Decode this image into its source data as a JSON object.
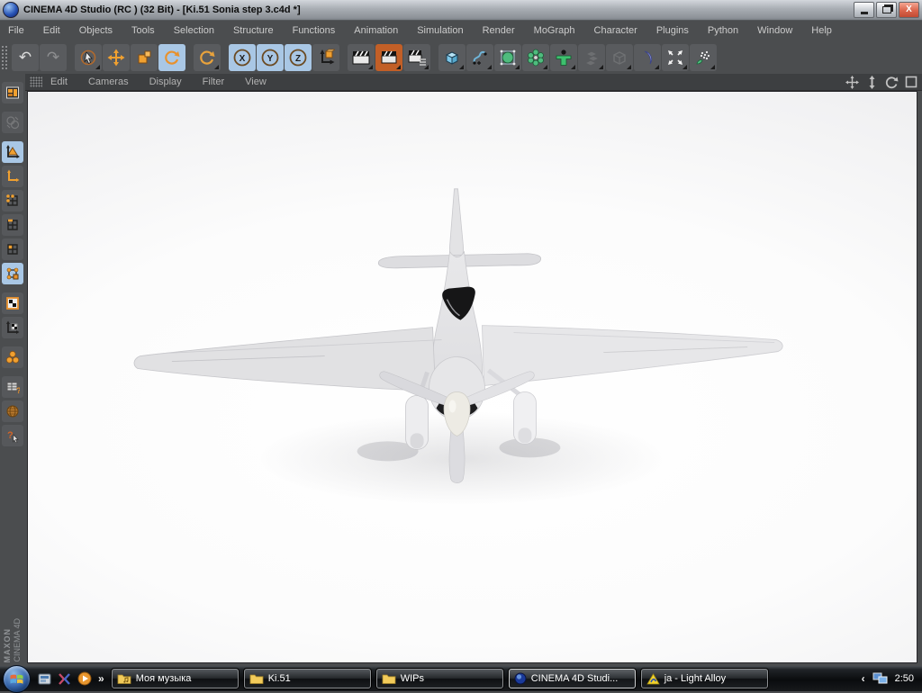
{
  "colors": {
    "accent_orange": "#f0a030",
    "highlight_blue": "#a9c7e5",
    "ui_dark": "#4b4d4f",
    "viewport_menu_dark": "#3d3f41",
    "close_red": "#d9634b",
    "taskbar_black": "#0a0c0e"
  },
  "window": {
    "title": "CINEMA 4D Studio (RC ) (32 Bit) - [Ki.51 Sonia step 3.c4d *]"
  },
  "menus": [
    "File",
    "Edit",
    "Objects",
    "Tools",
    "Selection",
    "Structure",
    "Functions",
    "Animation",
    "Simulation",
    "Render",
    "MoGraph",
    "Character",
    "Plugins",
    "Python",
    "Window",
    "Help"
  ],
  "toolbar": {
    "axis_locks": [
      "X",
      "Y",
      "Z"
    ],
    "icons": [
      "undo",
      "redo",
      "live-selection",
      "move",
      "scale",
      "rotate",
      "last-tool",
      "lock-x",
      "lock-y",
      "lock-z",
      "coordinate-system",
      "render-view",
      "render-picture-viewer",
      "render-settings",
      "add-cube",
      "spline-pen",
      "subdivision-surface",
      "array-objects",
      "character-objects",
      "deformer",
      "stage",
      "environment",
      "particles",
      "hair"
    ]
  },
  "viewport_menu": [
    "Edit",
    "Cameras",
    "Display",
    "Filter",
    "View"
  ],
  "viewport_nav": [
    "pan-view",
    "zoom-view",
    "rotate-view",
    "toggle-view"
  ],
  "sidebar_icons": [
    "layout",
    "convert",
    "model-mode",
    "object-axis-mode",
    "points-mode",
    "edges-mode",
    "polygons-mode",
    "uv-polygons-mode",
    "texture-mode",
    "texture-axis-mode",
    "kinematics-mode",
    "commander",
    "internet",
    "context-help"
  ],
  "branding": {
    "line1": "MAXON",
    "line2": "CINEMA 4D"
  },
  "taskbar": {
    "overflow_chevron": "»",
    "tray_chevron": "‹",
    "buttons": [
      {
        "label": "Моя музыка",
        "icon": "music-folder"
      },
      {
        "label": "Ki.51",
        "icon": "folder"
      },
      {
        "label": "WIPs",
        "icon": "folder"
      },
      {
        "label": "CINEMA 4D Studi...",
        "icon": "c4d-sphere",
        "active": true
      },
      {
        "label": "ja - Light Alloy",
        "icon": "light-alloy"
      }
    ],
    "clock": "2:50"
  }
}
